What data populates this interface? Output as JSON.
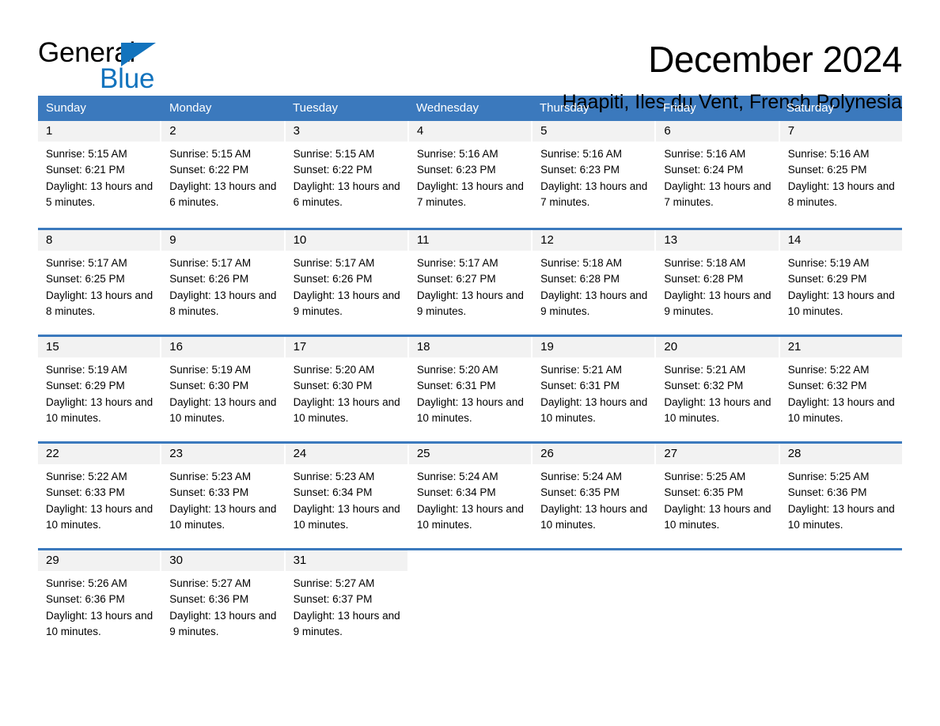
{
  "brand": {
    "word_one": "General",
    "word_two": "Blue",
    "triangle_icon": "triangle-logo-icon",
    "blue": "#1273bd"
  },
  "header": {
    "month_title": "December 2024",
    "location": "Haapiti, Iles du Vent, French Polynesia"
  },
  "colors": {
    "header_blue": "#3b79bd",
    "daynum_band": "#f2f2f2",
    "text": "#000000"
  },
  "calendar": {
    "weekdays": [
      "Sunday",
      "Monday",
      "Tuesday",
      "Wednesday",
      "Thursday",
      "Friday",
      "Saturday"
    ],
    "weeks": [
      [
        {
          "day": "1",
          "info": "Sunrise: 5:15 AM\nSunset: 6:21 PM\nDaylight: 13 hours and 5 minutes."
        },
        {
          "day": "2",
          "info": "Sunrise: 5:15 AM\nSunset: 6:22 PM\nDaylight: 13 hours and 6 minutes."
        },
        {
          "day": "3",
          "info": "Sunrise: 5:15 AM\nSunset: 6:22 PM\nDaylight: 13 hours and 6 minutes."
        },
        {
          "day": "4",
          "info": "Sunrise: 5:16 AM\nSunset: 6:23 PM\nDaylight: 13 hours and 7 minutes."
        },
        {
          "day": "5",
          "info": "Sunrise: 5:16 AM\nSunset: 6:23 PM\nDaylight: 13 hours and 7 minutes."
        },
        {
          "day": "6",
          "info": "Sunrise: 5:16 AM\nSunset: 6:24 PM\nDaylight: 13 hours and 7 minutes."
        },
        {
          "day": "7",
          "info": "Sunrise: 5:16 AM\nSunset: 6:25 PM\nDaylight: 13 hours and 8 minutes."
        }
      ],
      [
        {
          "day": "8",
          "info": "Sunrise: 5:17 AM\nSunset: 6:25 PM\nDaylight: 13 hours and 8 minutes."
        },
        {
          "day": "9",
          "info": "Sunrise: 5:17 AM\nSunset: 6:26 PM\nDaylight: 13 hours and 8 minutes."
        },
        {
          "day": "10",
          "info": "Sunrise: 5:17 AM\nSunset: 6:26 PM\nDaylight: 13 hours and 9 minutes."
        },
        {
          "day": "11",
          "info": "Sunrise: 5:17 AM\nSunset: 6:27 PM\nDaylight: 13 hours and 9 minutes."
        },
        {
          "day": "12",
          "info": "Sunrise: 5:18 AM\nSunset: 6:28 PM\nDaylight: 13 hours and 9 minutes."
        },
        {
          "day": "13",
          "info": "Sunrise: 5:18 AM\nSunset: 6:28 PM\nDaylight: 13 hours and 9 minutes."
        },
        {
          "day": "14",
          "info": "Sunrise: 5:19 AM\nSunset: 6:29 PM\nDaylight: 13 hours and 10 minutes."
        }
      ],
      [
        {
          "day": "15",
          "info": "Sunrise: 5:19 AM\nSunset: 6:29 PM\nDaylight: 13 hours and 10 minutes."
        },
        {
          "day": "16",
          "info": "Sunrise: 5:19 AM\nSunset: 6:30 PM\nDaylight: 13 hours and 10 minutes."
        },
        {
          "day": "17",
          "info": "Sunrise: 5:20 AM\nSunset: 6:30 PM\nDaylight: 13 hours and 10 minutes."
        },
        {
          "day": "18",
          "info": "Sunrise: 5:20 AM\nSunset: 6:31 PM\nDaylight: 13 hours and 10 minutes."
        },
        {
          "day": "19",
          "info": "Sunrise: 5:21 AM\nSunset: 6:31 PM\nDaylight: 13 hours and 10 minutes."
        },
        {
          "day": "20",
          "info": "Sunrise: 5:21 AM\nSunset: 6:32 PM\nDaylight: 13 hours and 10 minutes."
        },
        {
          "day": "21",
          "info": "Sunrise: 5:22 AM\nSunset: 6:32 PM\nDaylight: 13 hours and 10 minutes."
        }
      ],
      [
        {
          "day": "22",
          "info": "Sunrise: 5:22 AM\nSunset: 6:33 PM\nDaylight: 13 hours and 10 minutes."
        },
        {
          "day": "23",
          "info": "Sunrise: 5:23 AM\nSunset: 6:33 PM\nDaylight: 13 hours and 10 minutes."
        },
        {
          "day": "24",
          "info": "Sunrise: 5:23 AM\nSunset: 6:34 PM\nDaylight: 13 hours and 10 minutes."
        },
        {
          "day": "25",
          "info": "Sunrise: 5:24 AM\nSunset: 6:34 PM\nDaylight: 13 hours and 10 minutes."
        },
        {
          "day": "26",
          "info": "Sunrise: 5:24 AM\nSunset: 6:35 PM\nDaylight: 13 hours and 10 minutes."
        },
        {
          "day": "27",
          "info": "Sunrise: 5:25 AM\nSunset: 6:35 PM\nDaylight: 13 hours and 10 minutes."
        },
        {
          "day": "28",
          "info": "Sunrise: 5:25 AM\nSunset: 6:36 PM\nDaylight: 13 hours and 10 minutes."
        }
      ],
      [
        {
          "day": "29",
          "info": "Sunrise: 5:26 AM\nSunset: 6:36 PM\nDaylight: 13 hours and 10 minutes."
        },
        {
          "day": "30",
          "info": "Sunrise: 5:27 AM\nSunset: 6:36 PM\nDaylight: 13 hours and 9 minutes."
        },
        {
          "day": "31",
          "info": "Sunrise: 5:27 AM\nSunset: 6:37 PM\nDaylight: 13 hours and 9 minutes."
        },
        {
          "day": "",
          "info": ""
        },
        {
          "day": "",
          "info": ""
        },
        {
          "day": "",
          "info": ""
        },
        {
          "day": "",
          "info": ""
        }
      ]
    ]
  }
}
